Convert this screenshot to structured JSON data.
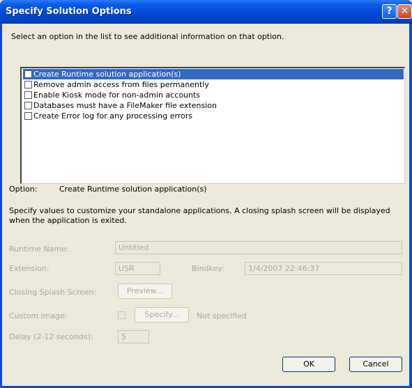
{
  "window": {
    "title": "Specify Solution Options",
    "help_label": "?",
    "close_label": "✕"
  },
  "instruction": "Select an option in the list to see additional information on that option.",
  "options_list": {
    "items": [
      {
        "label": "Create Runtime solution application(s)",
        "checked": false,
        "selected": true
      },
      {
        "label": "Remove admin access from files permanently",
        "checked": false,
        "selected": false
      },
      {
        "label": "Enable Kiosk mode for non-admin accounts",
        "checked": false,
        "selected": false
      },
      {
        "label": "Databases must have a FileMaker file extension",
        "checked": false,
        "selected": false
      },
      {
        "label": "Create Error log for any processing errors",
        "checked": false,
        "selected": false
      }
    ]
  },
  "option_summary": {
    "label": "Option:",
    "value": "Create Runtime solution application(s)"
  },
  "description": "Specify values to customize your standalone applications. A closing splash screen will be displayed when the application is exited.",
  "form": {
    "runtime_name_label": "Runtime Name:",
    "runtime_name_value": "Untitled",
    "extension_label": "Extension:",
    "extension_value": "USR",
    "bindkey_label": "Bindkey:",
    "bindkey_value": "1/4/2007 22:46:37",
    "closing_splash_label": "Closing Splash Screen:",
    "preview_button": "Preview...",
    "custom_image_label": "Custom image:",
    "specify_button": "Specify...",
    "custom_image_status": "Not specified",
    "delay_label": "Delay (2-12 seconds):",
    "delay_value": "5"
  },
  "buttons": {
    "ok": "OK",
    "cancel": "Cancel"
  },
  "colors": {
    "title_bar": "#0054e3",
    "selection": "#316ac5",
    "disabled_text": "#aca899",
    "dialog_bg": "#ece9d8"
  }
}
